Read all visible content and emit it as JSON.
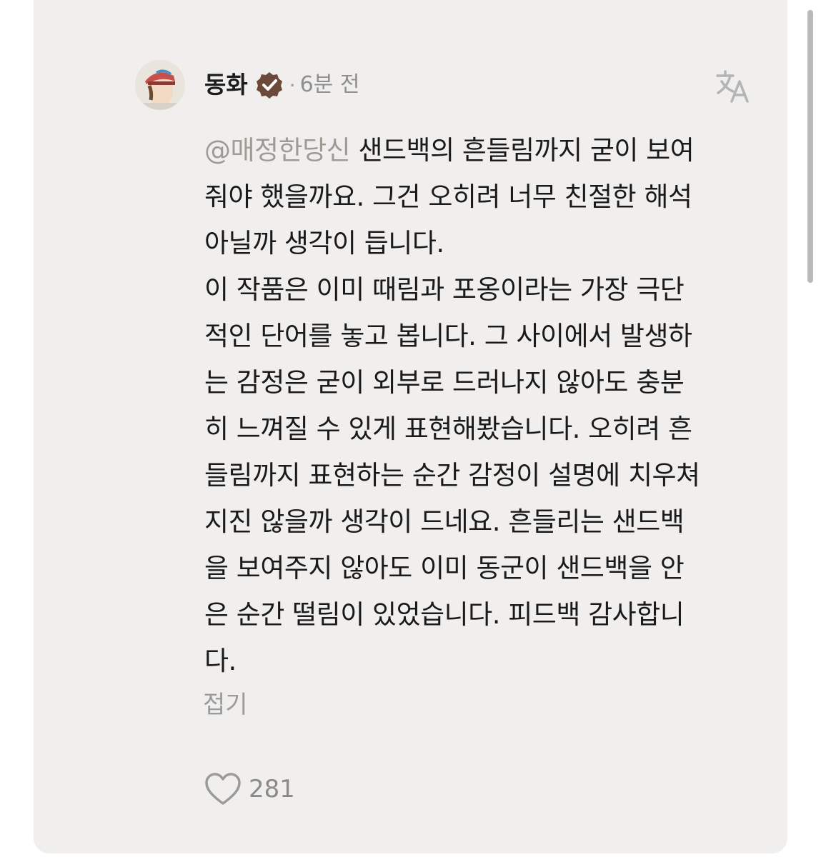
{
  "post": {
    "username": "동화",
    "dot": "·",
    "time": "6분 전",
    "mention": "@매정한당신",
    "lines": [
      " 샌드백의 흔들림까지 굳이 보여",
      "줘야 했을까요. 그건 오히려 너무 친절한 해석",
      "아닐까 생각이 듭니다.",
      "이 작품은 이미 때림과 포옹이라는 가장 극단",
      "적인 단어를 놓고 봅니다. 그 사이에서 발생하",
      "는 감정은  굳이 외부로 드러나지 않아도 충분",
      "히 느껴질 수 있게 표현해봤습니다. 오히려 흔",
      "들림까지 표현하는 순간 감정이 설명에 치우쳐",
      "지진 않을까 생각이 드네요. 흔들리는 샌드백",
      "을 보여주지 않아도 이미 동군이 샌드백을 안",
      "은 순간 떨림이 있었습니다. 피드백 감사합니",
      "다."
    ],
    "collapse_label": "접기",
    "like_count": "281"
  },
  "icons": {
    "verified": "verified-badge-icon",
    "translate": "translate-icon",
    "like": "heart-icon"
  },
  "colors": {
    "card_bg": "#f0efee",
    "badge": "#6b4a3a",
    "mention": "#a09a95"
  }
}
